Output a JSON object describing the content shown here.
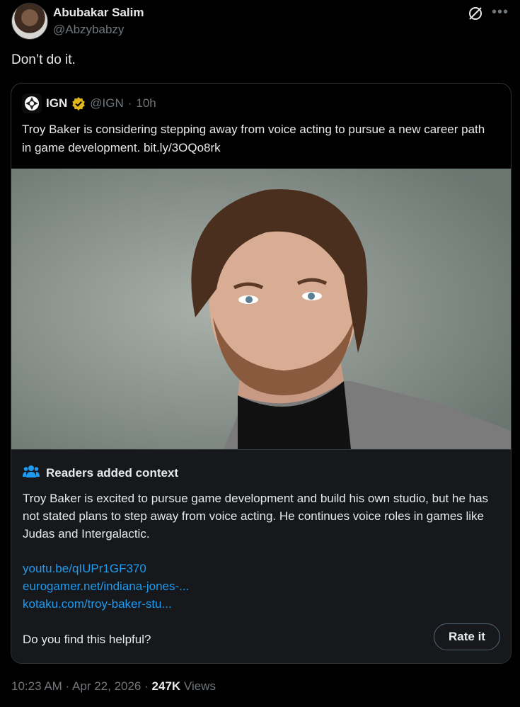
{
  "author": {
    "name": "Abubakar Salim",
    "handle": "@Abzybabzy"
  },
  "tweet": {
    "text": "Don’t do it."
  },
  "quoted": {
    "name": "IGN",
    "handle": "@IGN",
    "separator": "·",
    "time": "10h",
    "text": "Troy Baker is considering stepping away from voice acting to pursue a new career path in game development. bit.ly/3OQo8rk"
  },
  "context": {
    "title": "Readers added context",
    "text": "Troy Baker is excited to pursue game development and build his own studio, but he has not stated plans to step away from voice acting. He continues voice roles in games like Judas and Intergalactic.",
    "links": [
      "youtu.be/qIUPr1GF370",
      "eurogamer.net/indiana-jones-...",
      "kotaku.com/troy-baker-stu..."
    ],
    "helpful_question": "Do you find this helpful?",
    "rate_label": "Rate it"
  },
  "meta": {
    "time": "10:23 AM",
    "sep1": "·",
    "date": "Apr 22, 2026",
    "sep2": "·",
    "views_count": "247K",
    "views_label": "Views"
  },
  "colors": {
    "accent": "#1d9bf0",
    "background": "#000000",
    "muted": "#71767b",
    "verified": "#e2b719"
  }
}
